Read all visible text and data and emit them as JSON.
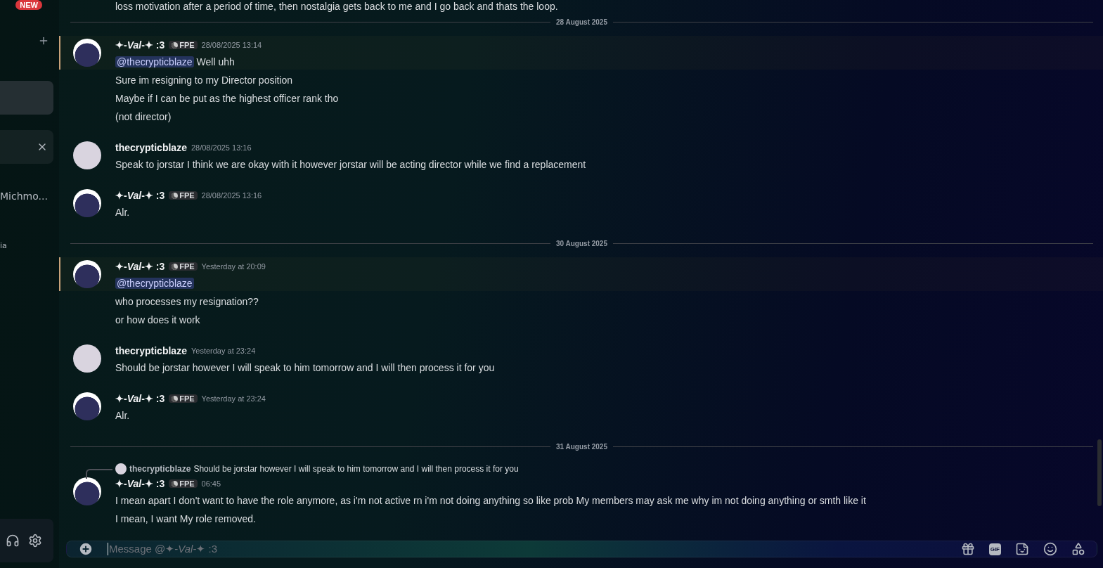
{
  "sidebar": {
    "badge": "NEW",
    "items": [
      {
        "selected": true,
        "hovered": false
      },
      {
        "selected": false,
        "hovered": true,
        "closable": true
      },
      {
        "selected": false,
        "hovered": false,
        "label": "Michmo..."
      },
      {
        "selected": false,
        "hovered": false,
        "label": "ia"
      }
    ]
  },
  "chat": {
    "messages": [
      {
        "kind": "continuation",
        "lines": [
          {
            "text": "loss motivation after a period of time, then nostalgia gets back to me and I go back and thats the loop."
          }
        ]
      },
      {
        "kind": "divider",
        "label": "28 August 2025"
      },
      {
        "kind": "message",
        "avatar": {
          "kind": "mascot"
        },
        "author": "✦-*Val*-✦ :3",
        "tag": "FPE",
        "timestamp": "28/08/2025 13:14",
        "mentioned": true,
        "lines": [
          {
            "mention": "@thecrypticblaze",
            "text": "Well uhh"
          },
          {
            "text": "Sure im resigning to my Director position"
          },
          {
            "text": "Maybe if I can be put as the highest officer rank tho"
          },
          {
            "text": "(not director)"
          }
        ]
      },
      {
        "kind": "message",
        "avatar": {
          "kind": "photo"
        },
        "author": "thecrypticblaze",
        "timestamp": "28/08/2025 13:16",
        "mentioned": false,
        "lines": [
          {
            "text": "Speak to jorstar I think we are okay with it however jorstar will be acting director while we find a replacement"
          }
        ]
      },
      {
        "kind": "message",
        "avatar": {
          "kind": "mascot"
        },
        "author": "✦-*Val*-✦ :3",
        "tag": "FPE",
        "timestamp": "28/08/2025 13:16",
        "mentioned": false,
        "lines": [
          {
            "text": "Alr."
          }
        ]
      },
      {
        "kind": "divider",
        "label": "30 August 2025"
      },
      {
        "kind": "message",
        "avatar": {
          "kind": "mascot"
        },
        "author": "✦-*Val*-✦ :3",
        "tag": "FPE",
        "timestamp": "Yesterday at 20:09",
        "mentioned": true,
        "lines": [
          {
            "mention": "@thecrypticblaze"
          },
          {
            "text": "who processes my resignation??"
          },
          {
            "text": "or how does it work"
          }
        ]
      },
      {
        "kind": "message",
        "avatar": {
          "kind": "photo"
        },
        "author": "thecrypticblaze",
        "timestamp": "Yesterday at 23:24",
        "mentioned": false,
        "lines": [
          {
            "text": "Should be jorstar however I will speak to him tomorrow and I will then process it for you"
          }
        ]
      },
      {
        "kind": "message",
        "avatar": {
          "kind": "mascot"
        },
        "author": "✦-*Val*-✦ :3",
        "tag": "FPE",
        "timestamp": "Yesterday at 23:24",
        "mentioned": false,
        "lines": [
          {
            "text": "Alr."
          }
        ]
      },
      {
        "kind": "divider",
        "label": "31 August 2025"
      },
      {
        "kind": "message",
        "avatar": {
          "kind": "mascot"
        },
        "author": "✦-*Val*-✦ :3",
        "tag": "FPE",
        "timestamp": "06:45",
        "mentioned": false,
        "reply": {
          "author": "thecrypticblaze",
          "text": "Should be jorstar however I will speak to him tomorrow and I will then process it for you"
        },
        "lines": [
          {
            "text": "I mean apart I don't want to have the role anymore, as i'm not active rn i'm not doing anything so like prob My members may ask me why im not doing anything or smth like it"
          },
          {
            "text": "I mean, I want My role removed."
          }
        ]
      }
    ]
  },
  "composer": {
    "placeholder": "Message @✦-*Val*-✦ :3",
    "buttons": [
      {
        "kind": "gift"
      },
      {
        "kind": "gif",
        "label": "GIF"
      },
      {
        "kind": "sticker"
      },
      {
        "kind": "emoji"
      },
      {
        "kind": "apps"
      }
    ]
  }
}
